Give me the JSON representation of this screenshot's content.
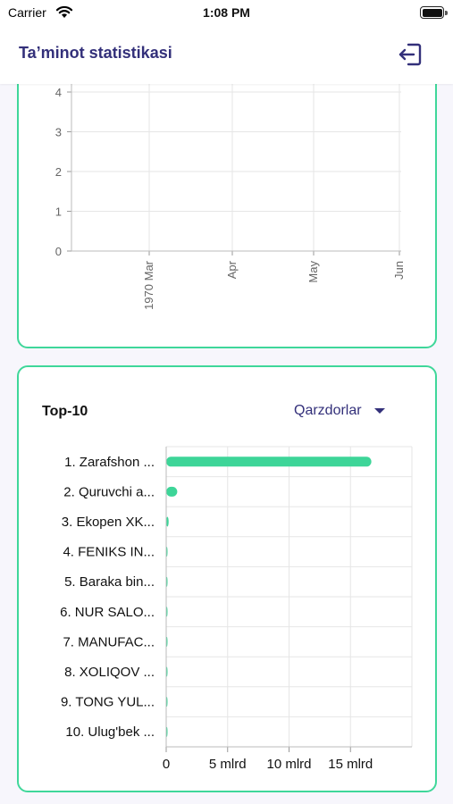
{
  "status_bar": {
    "carrier": "Carrier",
    "time": "1:08 PM"
  },
  "header": {
    "title": "Ta’minot statistikasi",
    "logout_icon": "logout-icon"
  },
  "time_chart": {
    "chart_data": {
      "type": "line",
      "yticks": [
        "0",
        "1",
        "2",
        "3",
        "4"
      ],
      "xticks": [
        "1970 Mar",
        "Apr",
        "May",
        "Jun"
      ],
      "ylim": [
        0,
        4
      ],
      "grid": true,
      "series": []
    }
  },
  "top10": {
    "title": "Top-10",
    "filter_label": "Qarzdorlar",
    "colors": {
      "bar": "#3dd598",
      "accent": "#33307a",
      "border": "#3fd79a"
    },
    "chart_data": {
      "type": "bar",
      "orientation": "horizontal",
      "categories": [
        "1.  Zarafshon ...",
        "2.  Quruvchi a...",
        "3.  Ekopen XK...",
        "4.  FENIKS IN...",
        "5.  Baraka bin...",
        "6.  NUR SALO...",
        "7.  MANUFAC...",
        "8.  XOLIQOV ...",
        "9.  TONG YUL...",
        "10.  Ulug'bek ..."
      ],
      "values": [
        16.7,
        0.9,
        0.2,
        0.1,
        0.1,
        0.1,
        0.05,
        0.05,
        0.02,
        0.02
      ],
      "unit": "mlrd",
      "xticks": [
        "0",
        "5 mlrd",
        "10 mlrd",
        "15 mlrd"
      ],
      "xlim": [
        0,
        20
      ],
      "grid": true
    }
  }
}
